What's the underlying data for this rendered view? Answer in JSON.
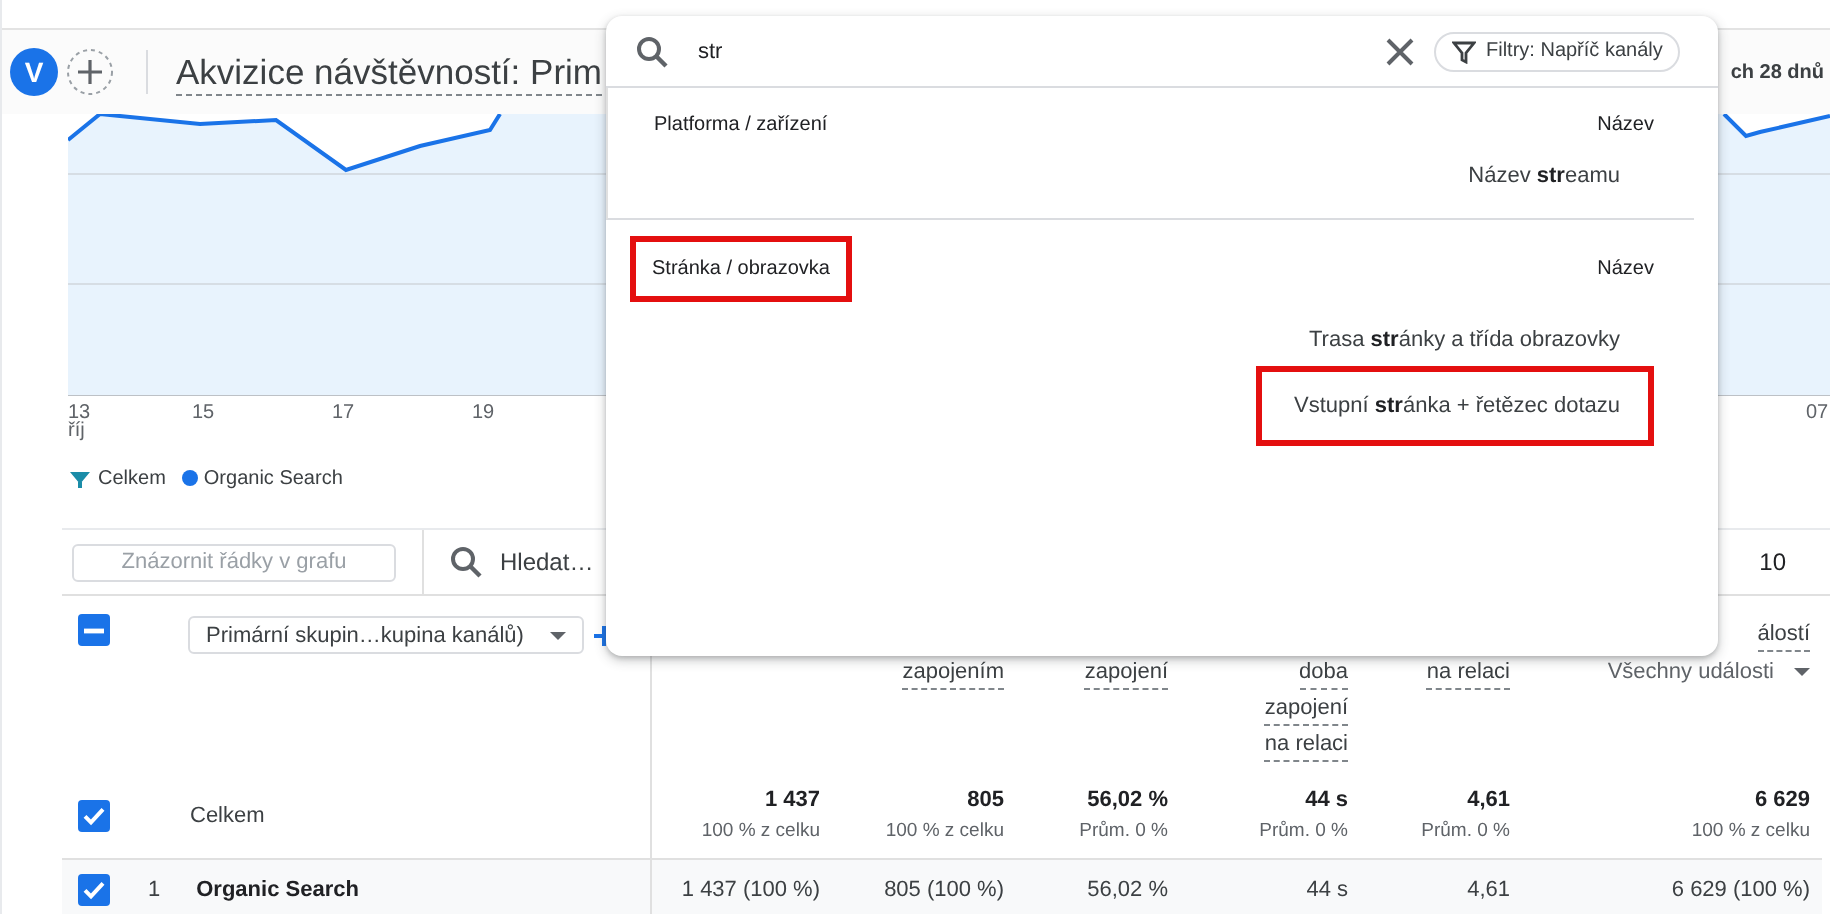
{
  "header": {
    "avatar": "V",
    "title": "Akvizice návštěvností: Prim",
    "date_range": "ch 28 dnů"
  },
  "chart": {
    "x_labels": [
      "13",
      "15",
      "17",
      "19",
      "07"
    ],
    "month": "říj",
    "legend": [
      {
        "label": "Celkem",
        "kind": "total"
      },
      {
        "label": "Organic Search",
        "kind": "series",
        "color": "#1a73e8"
      }
    ]
  },
  "toolbar": {
    "plot_rows": {
      "label": "Znázornit řádky v grafu",
      "disabled": true
    },
    "search_placeholder": "Hledat…",
    "rows_per_page": "10"
  },
  "table": {
    "select_all": {
      "indeterminate": true
    },
    "dimension": "Primární skupin…kupina kanálů)",
    "column_headers": [
      {
        "lines": [
          "zapojením"
        ]
      },
      {
        "lines": [
          "zapojení"
        ]
      },
      {
        "lines": [
          "doba",
          "zapojení",
          "na relaci"
        ]
      },
      {
        "lines": [
          "na relaci"
        ]
      },
      {
        "lines": [
          "álostí"
        ],
        "selector": "Všechny události"
      }
    ],
    "totals": {
      "label": "Celkem",
      "checked": true,
      "cells": [
        {
          "value": "1 437",
          "note": "100 % z celku"
        },
        {
          "value": "805",
          "note": "100 % z celku"
        },
        {
          "value": "56,02 %",
          "note": "Prům. 0 %"
        },
        {
          "value": "44 s",
          "note": "Prům. 0 %"
        },
        {
          "value": "4,61",
          "note": "Prům. 0 %"
        },
        {
          "value": "6 629",
          "note": "100 % z celku"
        }
      ]
    },
    "rows": [
      {
        "index": "1",
        "label": "Organic Search",
        "checked": true,
        "cells": [
          "1 437 (100 %)",
          "805 (100 %)",
          "56,02 %",
          "44 s",
          "4,61",
          "6 629 (100 %)"
        ]
      }
    ]
  },
  "dropdown": {
    "query": "str",
    "filter_chip": "Filtry: Napříč kanály",
    "groups": [
      {
        "title": "Platforma / zařízení",
        "column": "Název",
        "highlighted": false,
        "items": [
          {
            "label": "Název **str**eamu",
            "highlighted": false
          }
        ]
      },
      {
        "title": "Stránka / obrazovka",
        "column": "Název",
        "highlighted": true,
        "items": [
          {
            "label": "Trasa **str**ánky a třída obrazovky",
            "highlighted": false
          },
          {
            "label": "Vstupní **str**ánka + řetězec dotazu",
            "highlighted": true
          }
        ]
      }
    ]
  }
}
